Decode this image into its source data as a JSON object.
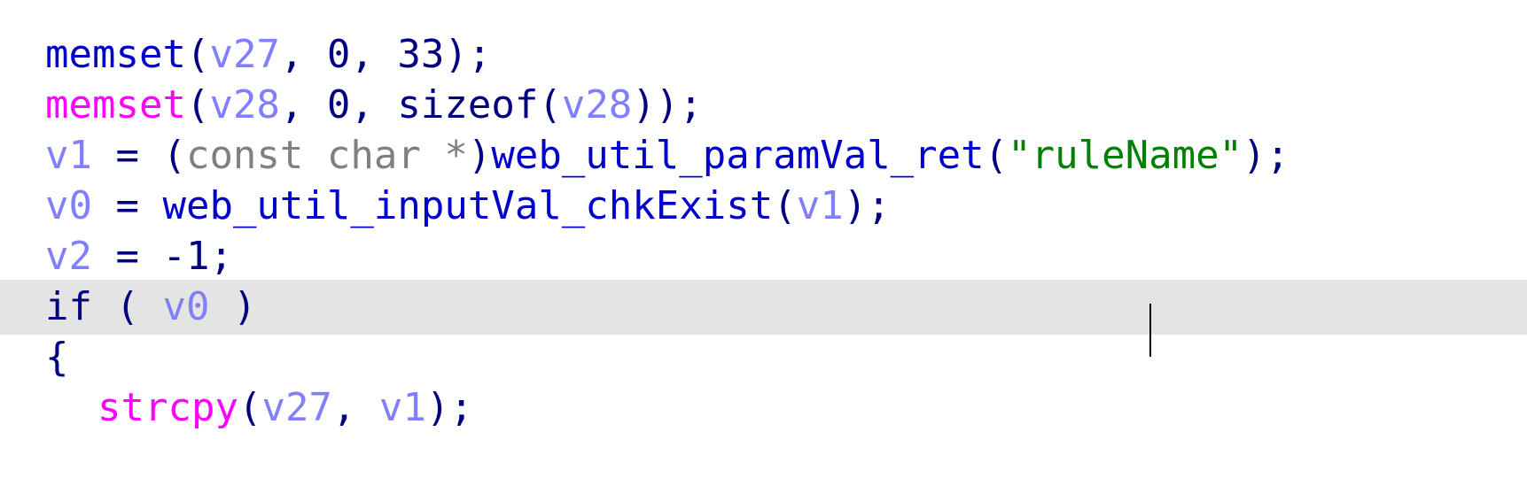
{
  "editor": {
    "lines": [
      {
        "tokens": [
          {
            "text": "memset",
            "kind": "fn"
          },
          {
            "text": "(",
            "kind": "punc"
          },
          {
            "text": "v27",
            "kind": "var"
          },
          {
            "text": ", 0, 33);",
            "kind": "punc"
          }
        ]
      },
      {
        "tokens": [
          {
            "text": "memset",
            "kind": "lib"
          },
          {
            "text": "(",
            "kind": "punc"
          },
          {
            "text": "v28",
            "kind": "var"
          },
          {
            "text": ", 0, sizeof(",
            "kind": "punc"
          },
          {
            "text": "v28",
            "kind": "var"
          },
          {
            "text": "));",
            "kind": "punc"
          }
        ]
      },
      {
        "tokens": [
          {
            "text": "v1",
            "kind": "var"
          },
          {
            "text": " = (",
            "kind": "punc"
          },
          {
            "text": "const char *",
            "kind": "type"
          },
          {
            "text": ")",
            "kind": "punc"
          },
          {
            "text": "web_util_paramVal_ret",
            "kind": "fn"
          },
          {
            "text": "(",
            "kind": "punc"
          },
          {
            "text": "\"ruleName\"",
            "kind": "str"
          },
          {
            "text": ");",
            "kind": "punc"
          }
        ]
      },
      {
        "tokens": [
          {
            "text": "v0",
            "kind": "var"
          },
          {
            "text": " = ",
            "kind": "punc"
          },
          {
            "text": "web_util_inputVal_chkExist",
            "kind": "fn"
          },
          {
            "text": "(",
            "kind": "punc"
          },
          {
            "text": "v1",
            "kind": "var"
          },
          {
            "text": ");",
            "kind": "punc"
          }
        ]
      },
      {
        "tokens": [
          {
            "text": "v2",
            "kind": "var"
          },
          {
            "text": " = -1;",
            "kind": "punc"
          }
        ]
      },
      {
        "current": true,
        "tokens": [
          {
            "text": "if",
            "kind": "kw"
          },
          {
            "text": " ( ",
            "kind": "punc"
          },
          {
            "text": "v0",
            "kind": "var"
          },
          {
            "text": " )",
            "kind": "punc"
          }
        ]
      },
      {
        "tokens": [
          {
            "text": "{",
            "kind": "punc"
          }
        ]
      },
      {
        "indent": true,
        "tokens": [
          {
            "text": "strcpy",
            "kind": "lib"
          },
          {
            "text": "(",
            "kind": "punc"
          },
          {
            "text": "v27",
            "kind": "var"
          },
          {
            "text": ", ",
            "kind": "punc"
          },
          {
            "text": "v1",
            "kind": "var"
          },
          {
            "text": ");",
            "kind": "punc"
          }
        ]
      }
    ],
    "colors": {
      "function": "#0000cc",
      "library_function": "#ff00ff",
      "variable": "#7f7fff",
      "punctuation": "#000080",
      "type": "#808080",
      "string": "#008000",
      "current_line_background": "#e4e4e4"
    }
  }
}
